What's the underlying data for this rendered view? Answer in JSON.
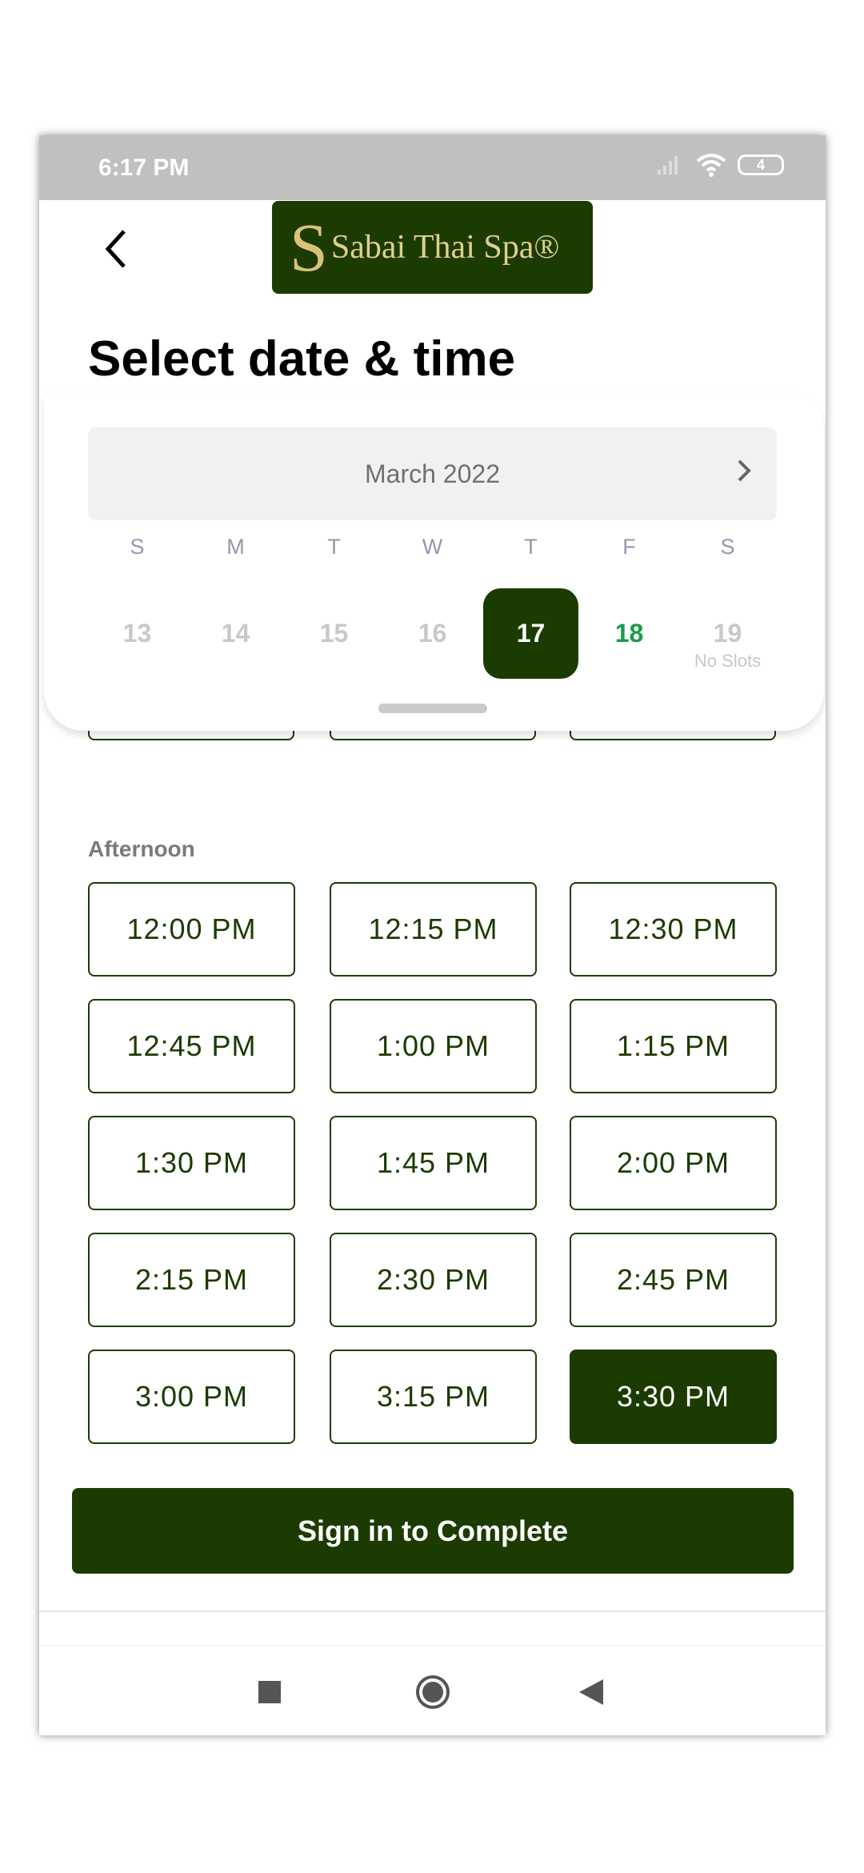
{
  "status_bar": {
    "time": "6:17 PM",
    "battery": "4",
    "icons": [
      "signal-icon",
      "wifi-icon",
      "battery-icon"
    ]
  },
  "header": {
    "back_icon": "chevron-left-icon",
    "logo_text": "Sabai Thai Spa®"
  },
  "title": "Select date & time",
  "calendar": {
    "month": "March 2022",
    "next_icon": "chevron-right-icon",
    "weekdays": [
      "S",
      "M",
      "T",
      "W",
      "T",
      "F",
      "S"
    ],
    "dates": [
      {
        "day": "13",
        "state": "disabled"
      },
      {
        "day": "14",
        "state": "disabled"
      },
      {
        "day": "15",
        "state": "disabled"
      },
      {
        "day": "16",
        "state": "disabled"
      },
      {
        "day": "17",
        "state": "selected"
      },
      {
        "day": "18",
        "state": "available"
      },
      {
        "day": "19",
        "state": "disabled",
        "note": "No Slots"
      }
    ]
  },
  "afternoon": {
    "label": "Afternoon",
    "slots": [
      "12:00 PM",
      "12:15 PM",
      "12:30 PM",
      "12:45 PM",
      "1:00 PM",
      "1:15 PM",
      "1:30 PM",
      "1:45 PM",
      "2:00 PM",
      "2:15 PM",
      "2:30 PM",
      "2:45 PM",
      "3:00 PM",
      "3:15 PM",
      "3:30 PM"
    ],
    "selected": "3:30 PM"
  },
  "cta": "Sign in to Complete",
  "colors": {
    "brand": "#1c3b00",
    "available": "#1a9a4a"
  },
  "navbar": [
    "recents-icon",
    "home-icon",
    "back-icon"
  ]
}
